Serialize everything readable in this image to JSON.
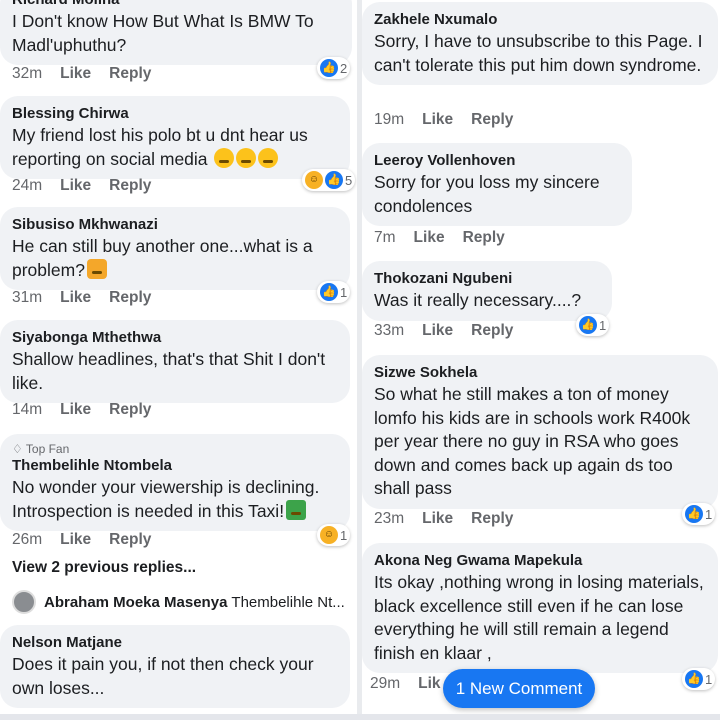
{
  "left": {
    "comments": [
      {
        "author": "Richard Molina",
        "text": "I Don't know How But What Is BMW To Madl'uphuthu?",
        "time": "32m",
        "like": "Like",
        "reply": "Reply",
        "reaction_count": "2"
      },
      {
        "author": "Blessing Chirwa",
        "text": "My friend lost his polo bt u dnt hear us reporting on social media",
        "time": "24m",
        "like": "Like",
        "reply": "Reply",
        "reaction_count": "5"
      },
      {
        "author": "Sibusiso Mkhwanazi",
        "text": "He can still buy another one...what is a problem?",
        "time": "31m",
        "like": "Like",
        "reply": "Reply",
        "reaction_count": "1"
      },
      {
        "author": "Siyabonga Mthethwa",
        "text": "Shallow headlines, that's that Shit I don't like.",
        "time": "14m",
        "like": "Like",
        "reply": "Reply"
      },
      {
        "badge": "Top Fan",
        "author": "Thembelihle Ntombela",
        "text": "No wonder your viewership is declining. Introspection is needed in this Taxi!",
        "time": "26m",
        "like": "Like",
        "reply": "Reply",
        "reaction_count": "1"
      },
      {
        "author": "Nelson Matjane",
        "text": "Does it pain you, if not then check your own loses..."
      }
    ],
    "view_previous": "View 2 previous replies...",
    "reply_preview": {
      "author": "Abraham Moeka Masenya",
      "text": "Thembelihle Nt..."
    }
  },
  "right": {
    "comments": [
      {
        "author": "Zakhele Nxumalo",
        "text": "Sorry, I have to unsubscribe to this Page. I can't tolerate this put him down syndrome.",
        "time": "19m",
        "like": "Like",
        "reply": "Reply"
      },
      {
        "author": "Leeroy Vollenhoven",
        "text": "Sorry for you loss my sincere condolences",
        "time": "7m",
        "like": "Like",
        "reply": "Reply"
      },
      {
        "author": "Thokozani Ngubeni",
        "text": "Was it really necessary....?",
        "time": "33m",
        "like": "Like",
        "reply": "Reply",
        "reaction_count": "1"
      },
      {
        "author": "Sizwe Sokhela",
        "text": "So what he still makes a ton of money lomfo his kids are in schools work R400k per year there no guy in RSA who goes down and comes back up again ds too shall pass",
        "time": "23m",
        "like": "Like",
        "reply": "Reply",
        "reaction_count": "1"
      },
      {
        "author": "Akona Neg Gwama Mapekula",
        "text": "Its okay ,nothing wrong in losing materials, black  excellence still even if he can lose everything  he will still remain a legend finish en klaar ,",
        "time": "29m",
        "like": "Lik",
        "reaction_count": "1"
      }
    ]
  },
  "new_comment_button": "1 New Comment"
}
